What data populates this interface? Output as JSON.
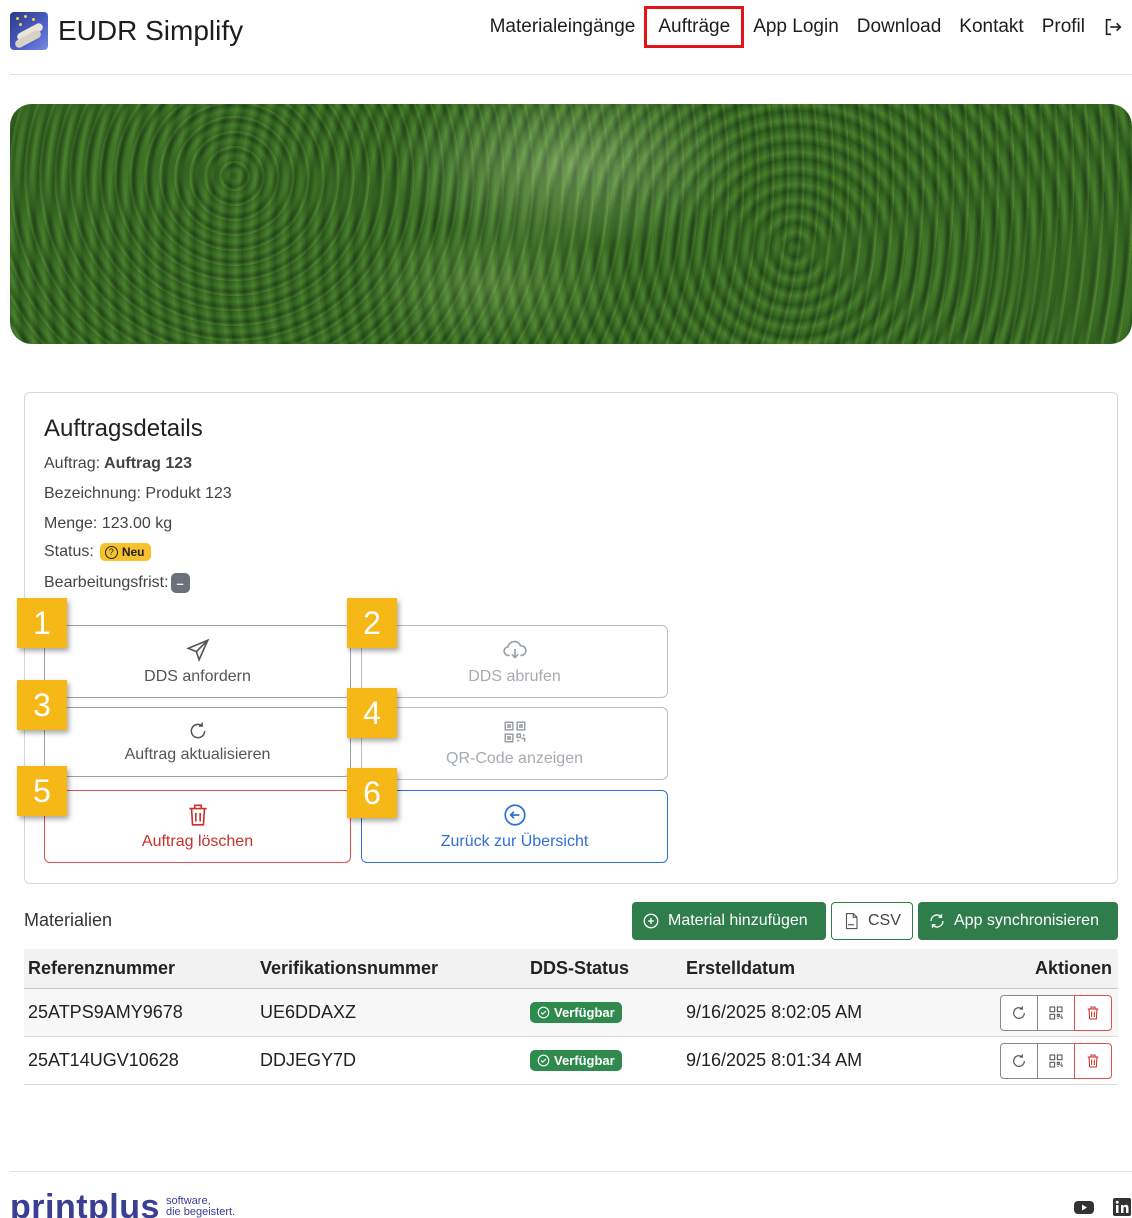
{
  "brand": {
    "name": "EUDR Simplify",
    "logo_icon": "timber-logs-icon"
  },
  "nav": {
    "items": [
      {
        "label": "Materialeingänge",
        "active": false
      },
      {
        "label": "Aufträge",
        "active": true
      },
      {
        "label": "App Login",
        "active": false
      },
      {
        "label": "Download",
        "active": false
      },
      {
        "label": "Kontakt",
        "active": false
      },
      {
        "label": "Profil",
        "active": false
      }
    ],
    "logout_icon": "logout-icon"
  },
  "order": {
    "title": "Auftragsdetails",
    "auftrag_label": "Auftrag:",
    "auftrag_value": "Auftrag 123",
    "bezeichnung": "Bezeichnung: Produkt 123",
    "menge": "Menge: 123.00 kg",
    "status_label": "Status:",
    "status_value": "Neu",
    "frist_label": "Bearbeitungsfrist:",
    "frist_value": "–"
  },
  "actions": {
    "dds_anfordern": "DDS anfordern",
    "dds_abrufen": "DDS abrufen",
    "aktualisieren": "Auftrag aktualisieren",
    "qr_code": "QR-Code anzeigen",
    "loeschen": "Auftrag löschen",
    "zurueck": "Zurück zur Übersicht"
  },
  "markers": [
    "1",
    "2",
    "3",
    "4",
    "5",
    "6"
  ],
  "materials": {
    "title": "Materialien",
    "add_label": "Material hinzufügen",
    "csv_label": "CSV",
    "sync_label": "App synchronisieren",
    "columns": [
      "Referenznummer",
      "Verifikationsnummer",
      "DDS-Status",
      "Erstelldatum",
      "Aktionen"
    ],
    "rows": [
      {
        "ref": "25ATPS9AMY9678",
        "verif": "UE6DDAXZ",
        "status": "Verfügbar",
        "date": "9/16/2025 8:02:05 AM"
      },
      {
        "ref": "25AT14UGV10628",
        "verif": "DDJEGY7D",
        "status": "Verfügbar",
        "date": "9/16/2025 8:01:34 AM"
      }
    ]
  },
  "footer": {
    "logo": "printplus",
    "tagline_1": "software,",
    "tagline_2": "die begeistert.",
    "icons": [
      "youtube-icon",
      "linkedin-icon"
    ]
  },
  "colors": {
    "accent_green": "#2f7d4a",
    "status_yellow": "#f6c12a",
    "danger": "#d9534f",
    "primary_blue": "#2f6fd6",
    "marker_yellow": "#f6b816",
    "highlight_red": "#e0141b"
  }
}
